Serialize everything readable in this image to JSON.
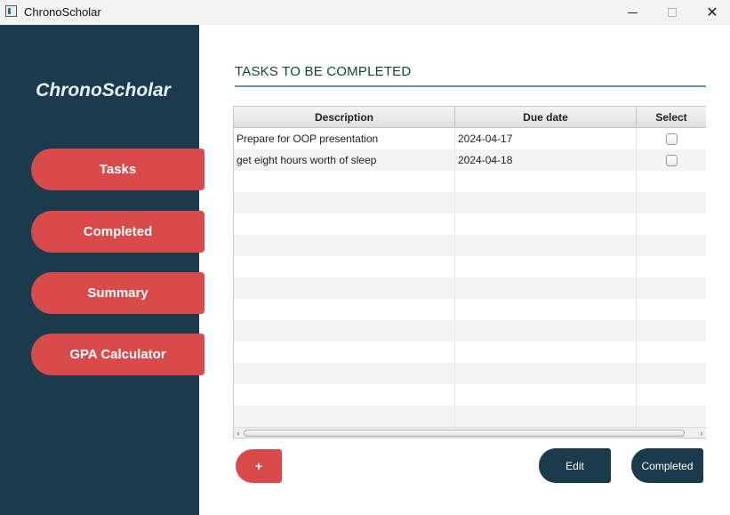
{
  "window": {
    "title": "ChronoScholar",
    "minimize_icon": "minimize-icon",
    "maximize_icon": "maximize-icon",
    "close_icon": "close-icon",
    "close_glyph": "✕"
  },
  "sidebar": {
    "brand": "ChronoScholar",
    "color": "#1b3a4b",
    "button_color": "#d94a4b",
    "nav": {
      "tasks": "Tasks",
      "completed": "Completed",
      "summary": "Summary",
      "gpa": "GPA Calculator"
    }
  },
  "main": {
    "heading": "TASKS TO BE COMPLETED",
    "table": {
      "columns": {
        "description": "Description",
        "due_date": "Due date",
        "select": "Select"
      },
      "rows": [
        {
          "description": "Prepare for OOP presentation",
          "due_date": "2024-04-17",
          "selected": false
        },
        {
          "description": "get eight hours worth of sleep",
          "due_date": "2024-04-18",
          "selected": false
        }
      ],
      "empty_rows": 12
    },
    "scroll": {
      "left_arrow": "‹",
      "right_arrow": "›"
    },
    "buttons": {
      "add": "+",
      "edit": "Edit",
      "completed": "Completed"
    }
  }
}
